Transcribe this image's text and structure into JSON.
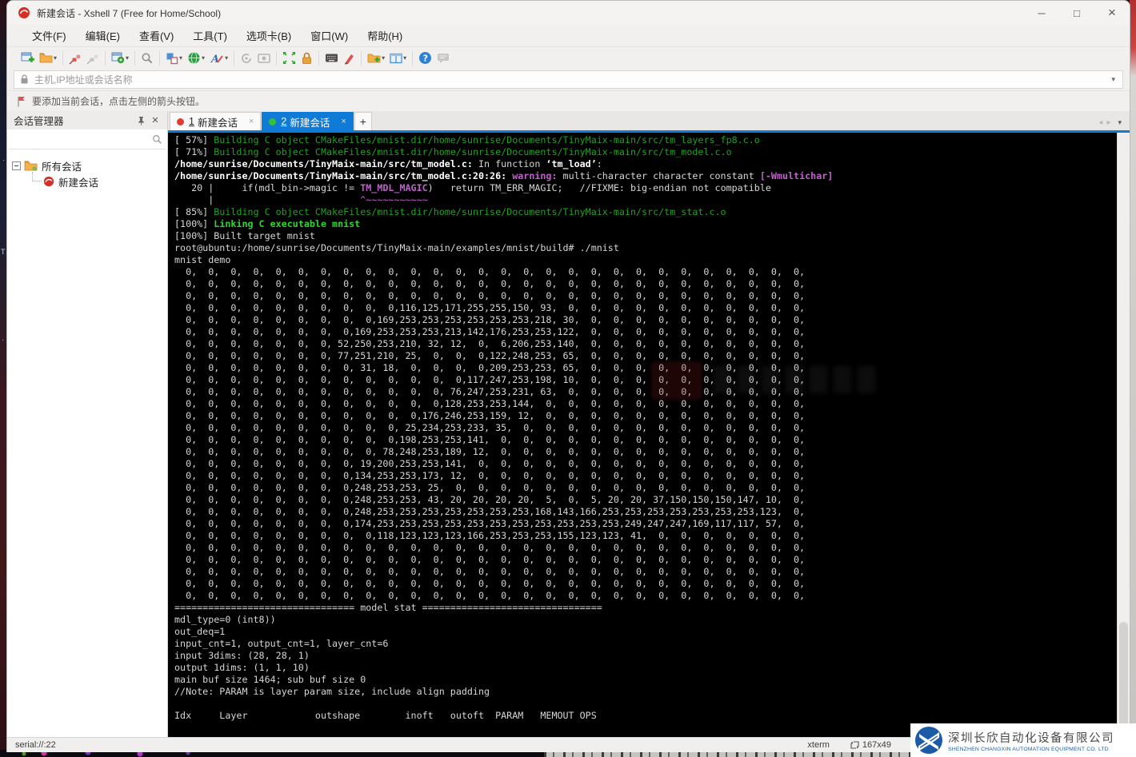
{
  "window": {
    "title": "新建会话 - Xshell 7 (Free for Home/School)"
  },
  "menu": {
    "items": [
      "文件(F)",
      "编辑(E)",
      "查看(V)",
      "工具(T)",
      "选项卡(B)",
      "窗口(W)",
      "帮助(H)"
    ]
  },
  "toolbar": {
    "icons": [
      "new-session",
      "open-session-folder",
      "disconnect",
      "reconnect",
      "session-properties",
      "find",
      "tile-windows",
      "web-tools",
      "font",
      "compose-bar",
      "capture",
      "fullscreen",
      "lock-screen",
      "virtual-keyboard",
      "highlighter-pen",
      "new-session-folder",
      "split-layout",
      "help",
      "message"
    ]
  },
  "address_bar": {
    "placeholder": "主机,IP地址或会话名称"
  },
  "info_bar": {
    "text": "要添加当前会话，点击左侧的箭头按钮。"
  },
  "session_manager": {
    "title": "会话管理器",
    "tree": {
      "root_label": "所有会话",
      "child_label": "新建会话"
    }
  },
  "tabs": {
    "items": [
      {
        "num": "1",
        "label": "新建会话",
        "close": "×"
      },
      {
        "num": "2",
        "label": "新建会话",
        "close": "×"
      }
    ],
    "add_label": "+"
  },
  "terminal": {
    "pre_lines": [
      [
        [
          "w",
          "[ 57%] "
        ],
        [
          "g",
          "Building C object CMakeFiles/mnist.dir/home/sunrise/Documents/TinyMaix-main/src/tm_layers_fp8.c.o"
        ]
      ],
      [
        [
          "w",
          "[ 71%] "
        ],
        [
          "g",
          "Building C object CMakeFiles/mnist.dir/home/sunrise/Documents/TinyMaix-main/src/tm_model.c.o"
        ]
      ],
      [
        [
          "W",
          "/home/sunrise/Documents/TinyMaix-main/src/tm_model.c:"
        ],
        [
          "w",
          " In function "
        ],
        [
          "W",
          "‘tm_load’"
        ],
        [
          "w",
          ":"
        ]
      ],
      [
        [
          "W",
          "/home/sunrise/Documents/TinyMaix-main/src/tm_model.c:20:26: "
        ],
        [
          "M",
          "warning:"
        ],
        [
          "w",
          " multi-character character constant "
        ],
        [
          "M",
          "[-Wmultichar]"
        ]
      ],
      [
        [
          "w",
          "   20 |     if(mdl_bin->magic != "
        ],
        [
          "M",
          "TM_MDL_MAGIC"
        ],
        [
          "w",
          ")   return TM_ERR_MAGIC;   //FIXME: big-endian not compatible"
        ]
      ],
      [
        [
          "w",
          "      |                          "
        ],
        [
          "m",
          "^~~~~~~~~~~~"
        ]
      ],
      [
        [
          "w",
          "[ 85%] "
        ],
        [
          "g",
          "Building C object CMakeFiles/mnist.dir/home/sunrise/Documents/TinyMaix-main/src/tm_stat.c.o"
        ]
      ],
      [
        [
          "w",
          "[100%] "
        ],
        [
          "G",
          "Linking C executable mnist"
        ]
      ],
      [
        [
          "w",
          "[100%] Built target mnist"
        ]
      ],
      [
        [
          "w",
          "root@ubuntu:/home/sunrise/Documents/TinyMaix-main/examples/mnist/build# ./mnist"
        ]
      ],
      [
        [
          "w",
          "mnist demo"
        ]
      ]
    ],
    "matrix": [
      [
        0,
        0,
        0,
        0,
        0,
        0,
        0,
        0,
        0,
        0,
        0,
        0,
        0,
        0,
        0,
        0,
        0,
        0,
        0,
        0,
        0,
        0,
        0,
        0,
        0,
        0,
        0,
        0
      ],
      [
        0,
        0,
        0,
        0,
        0,
        0,
        0,
        0,
        0,
        0,
        0,
        0,
        0,
        0,
        0,
        0,
        0,
        0,
        0,
        0,
        0,
        0,
        0,
        0,
        0,
        0,
        0,
        0
      ],
      [
        0,
        0,
        0,
        0,
        0,
        0,
        0,
        0,
        0,
        0,
        0,
        0,
        0,
        0,
        0,
        0,
        0,
        0,
        0,
        0,
        0,
        0,
        0,
        0,
        0,
        0,
        0,
        0
      ],
      [
        0,
        0,
        0,
        0,
        0,
        0,
        0,
        0,
        0,
        0,
        116,
        125,
        171,
        255,
        255,
        150,
        93,
        0,
        0,
        0,
        0,
        0,
        0,
        0,
        0,
        0,
        0,
        0
      ],
      [
        0,
        0,
        0,
        0,
        0,
        0,
        0,
        0,
        0,
        169,
        253,
        253,
        253,
        253,
        253,
        253,
        218,
        30,
        0,
        0,
        0,
        0,
        0,
        0,
        0,
        0,
        0,
        0
      ],
      [
        0,
        0,
        0,
        0,
        0,
        0,
        0,
        0,
        169,
        253,
        253,
        253,
        213,
        142,
        176,
        253,
        253,
        122,
        0,
        0,
        0,
        0,
        0,
        0,
        0,
        0,
        0,
        0
      ],
      [
        0,
        0,
        0,
        0,
        0,
        0,
        0,
        52,
        250,
        253,
        210,
        32,
        12,
        0,
        6,
        206,
        253,
        140,
        0,
        0,
        0,
        0,
        0,
        0,
        0,
        0,
        0,
        0
      ],
      [
        0,
        0,
        0,
        0,
        0,
        0,
        0,
        77,
        251,
        210,
        25,
        0,
        0,
        0,
        122,
        248,
        253,
        65,
        0,
        0,
        0,
        0,
        0,
        0,
        0,
        0,
        0,
        0
      ],
      [
        0,
        0,
        0,
        0,
        0,
        0,
        0,
        0,
        31,
        18,
        0,
        0,
        0,
        0,
        209,
        253,
        253,
        65,
        0,
        0,
        0,
        0,
        0,
        0,
        0,
        0,
        0,
        0
      ],
      [
        0,
        0,
        0,
        0,
        0,
        0,
        0,
        0,
        0,
        0,
        0,
        0,
        0,
        117,
        247,
        253,
        198,
        10,
        0,
        0,
        0,
        0,
        0,
        0,
        0,
        0,
        0,
        0
      ],
      [
        0,
        0,
        0,
        0,
        0,
        0,
        0,
        0,
        0,
        0,
        0,
        0,
        76,
        247,
        253,
        231,
        63,
        0,
        0,
        0,
        0,
        0,
        0,
        0,
        0,
        0,
        0,
        0
      ],
      [
        0,
        0,
        0,
        0,
        0,
        0,
        0,
        0,
        0,
        0,
        0,
        0,
        128,
        253,
        253,
        144,
        0,
        0,
        0,
        0,
        0,
        0,
        0,
        0,
        0,
        0,
        0,
        0
      ],
      [
        0,
        0,
        0,
        0,
        0,
        0,
        0,
        0,
        0,
        0,
        0,
        176,
        246,
        253,
        159,
        12,
        0,
        0,
        0,
        0,
        0,
        0,
        0,
        0,
        0,
        0,
        0,
        0
      ],
      [
        0,
        0,
        0,
        0,
        0,
        0,
        0,
        0,
        0,
        0,
        25,
        234,
        253,
        233,
        35,
        0,
        0,
        0,
        0,
        0,
        0,
        0,
        0,
        0,
        0,
        0,
        0,
        0
      ],
      [
        0,
        0,
        0,
        0,
        0,
        0,
        0,
        0,
        0,
        0,
        198,
        253,
        253,
        141,
        0,
        0,
        0,
        0,
        0,
        0,
        0,
        0,
        0,
        0,
        0,
        0,
        0,
        0
      ],
      [
        0,
        0,
        0,
        0,
        0,
        0,
        0,
        0,
        0,
        78,
        248,
        253,
        189,
        12,
        0,
        0,
        0,
        0,
        0,
        0,
        0,
        0,
        0,
        0,
        0,
        0,
        0,
        0
      ],
      [
        0,
        0,
        0,
        0,
        0,
        0,
        0,
        0,
        19,
        200,
        253,
        253,
        141,
        0,
        0,
        0,
        0,
        0,
        0,
        0,
        0,
        0,
        0,
        0,
        0,
        0,
        0,
        0
      ],
      [
        0,
        0,
        0,
        0,
        0,
        0,
        0,
        0,
        134,
        253,
        253,
        173,
        12,
        0,
        0,
        0,
        0,
        0,
        0,
        0,
        0,
        0,
        0,
        0,
        0,
        0,
        0,
        0
      ],
      [
        0,
        0,
        0,
        0,
        0,
        0,
        0,
        0,
        248,
        253,
        253,
        25,
        0,
        0,
        0,
        0,
        0,
        0,
        0,
        0,
        0,
        0,
        0,
        0,
        0,
        0,
        0,
        0
      ],
      [
        0,
        0,
        0,
        0,
        0,
        0,
        0,
        0,
        248,
        253,
        253,
        43,
        20,
        20,
        20,
        20,
        5,
        0,
        5,
        20,
        20,
        37,
        150,
        150,
        150,
        147,
        10,
        0
      ],
      [
        0,
        0,
        0,
        0,
        0,
        0,
        0,
        0,
        248,
        253,
        253,
        253,
        253,
        253,
        253,
        253,
        168,
        143,
        166,
        253,
        253,
        253,
        253,
        253,
        253,
        253,
        123,
        0
      ],
      [
        0,
        0,
        0,
        0,
        0,
        0,
        0,
        0,
        174,
        253,
        253,
        253,
        253,
        253,
        253,
        253,
        253,
        253,
        253,
        253,
        249,
        247,
        247,
        169,
        117,
        117,
        57,
        0
      ],
      [
        0,
        0,
        0,
        0,
        0,
        0,
        0,
        0,
        0,
        118,
        123,
        123,
        123,
        166,
        253,
        253,
        253,
        155,
        123,
        123,
        41,
        0,
        0,
        0,
        0,
        0,
        0,
        0
      ],
      [
        0,
        0,
        0,
        0,
        0,
        0,
        0,
        0,
        0,
        0,
        0,
        0,
        0,
        0,
        0,
        0,
        0,
        0,
        0,
        0,
        0,
        0,
        0,
        0,
        0,
        0,
        0,
        0
      ],
      [
        0,
        0,
        0,
        0,
        0,
        0,
        0,
        0,
        0,
        0,
        0,
        0,
        0,
        0,
        0,
        0,
        0,
        0,
        0,
        0,
        0,
        0,
        0,
        0,
        0,
        0,
        0,
        0
      ],
      [
        0,
        0,
        0,
        0,
        0,
        0,
        0,
        0,
        0,
        0,
        0,
        0,
        0,
        0,
        0,
        0,
        0,
        0,
        0,
        0,
        0,
        0,
        0,
        0,
        0,
        0,
        0,
        0
      ],
      [
        0,
        0,
        0,
        0,
        0,
        0,
        0,
        0,
        0,
        0,
        0,
        0,
        0,
        0,
        0,
        0,
        0,
        0,
        0,
        0,
        0,
        0,
        0,
        0,
        0,
        0,
        0,
        0
      ],
      [
        0,
        0,
        0,
        0,
        0,
        0,
        0,
        0,
        0,
        0,
        0,
        0,
        0,
        0,
        0,
        0,
        0,
        0,
        0,
        0,
        0,
        0,
        0,
        0,
        0,
        0,
        0,
        0
      ]
    ],
    "post_lines": [
      "================================ model stat ================================",
      "mdl_type=0 (int8))",
      "out_deq=1",
      "input_cnt=1, output_cnt=1, layer_cnt=6",
      "input 3dims: (28, 28, 1)",
      "output 1dims: (1, 1, 10)",
      "main buf size 1464; sub buf size 0",
      "//Note: PARAM is layer param size, include align padding",
      "",
      "Idx     Layer            outshape        inoft   outoft  PARAM   MEMOUT OPS"
    ]
  },
  "status_bar": {
    "left": "serial://:22",
    "terminal_type": "xterm",
    "size": "167x49"
  },
  "logo": {
    "cn": "深圳长欣自动化设备有限公司",
    "en": "SHENZHEN CHANGXIN AUTOMATION EQUIPMENT CO. LTD"
  },
  "colors": {
    "tab_active_blue": "#0f7bd7",
    "terminal_green": "#1fa31f",
    "terminal_bright_green": "#2fd42f",
    "terminal_magenta": "#c061cb",
    "logo_blue": "#1b5ea8",
    "xshell_red": "#d62f28"
  }
}
